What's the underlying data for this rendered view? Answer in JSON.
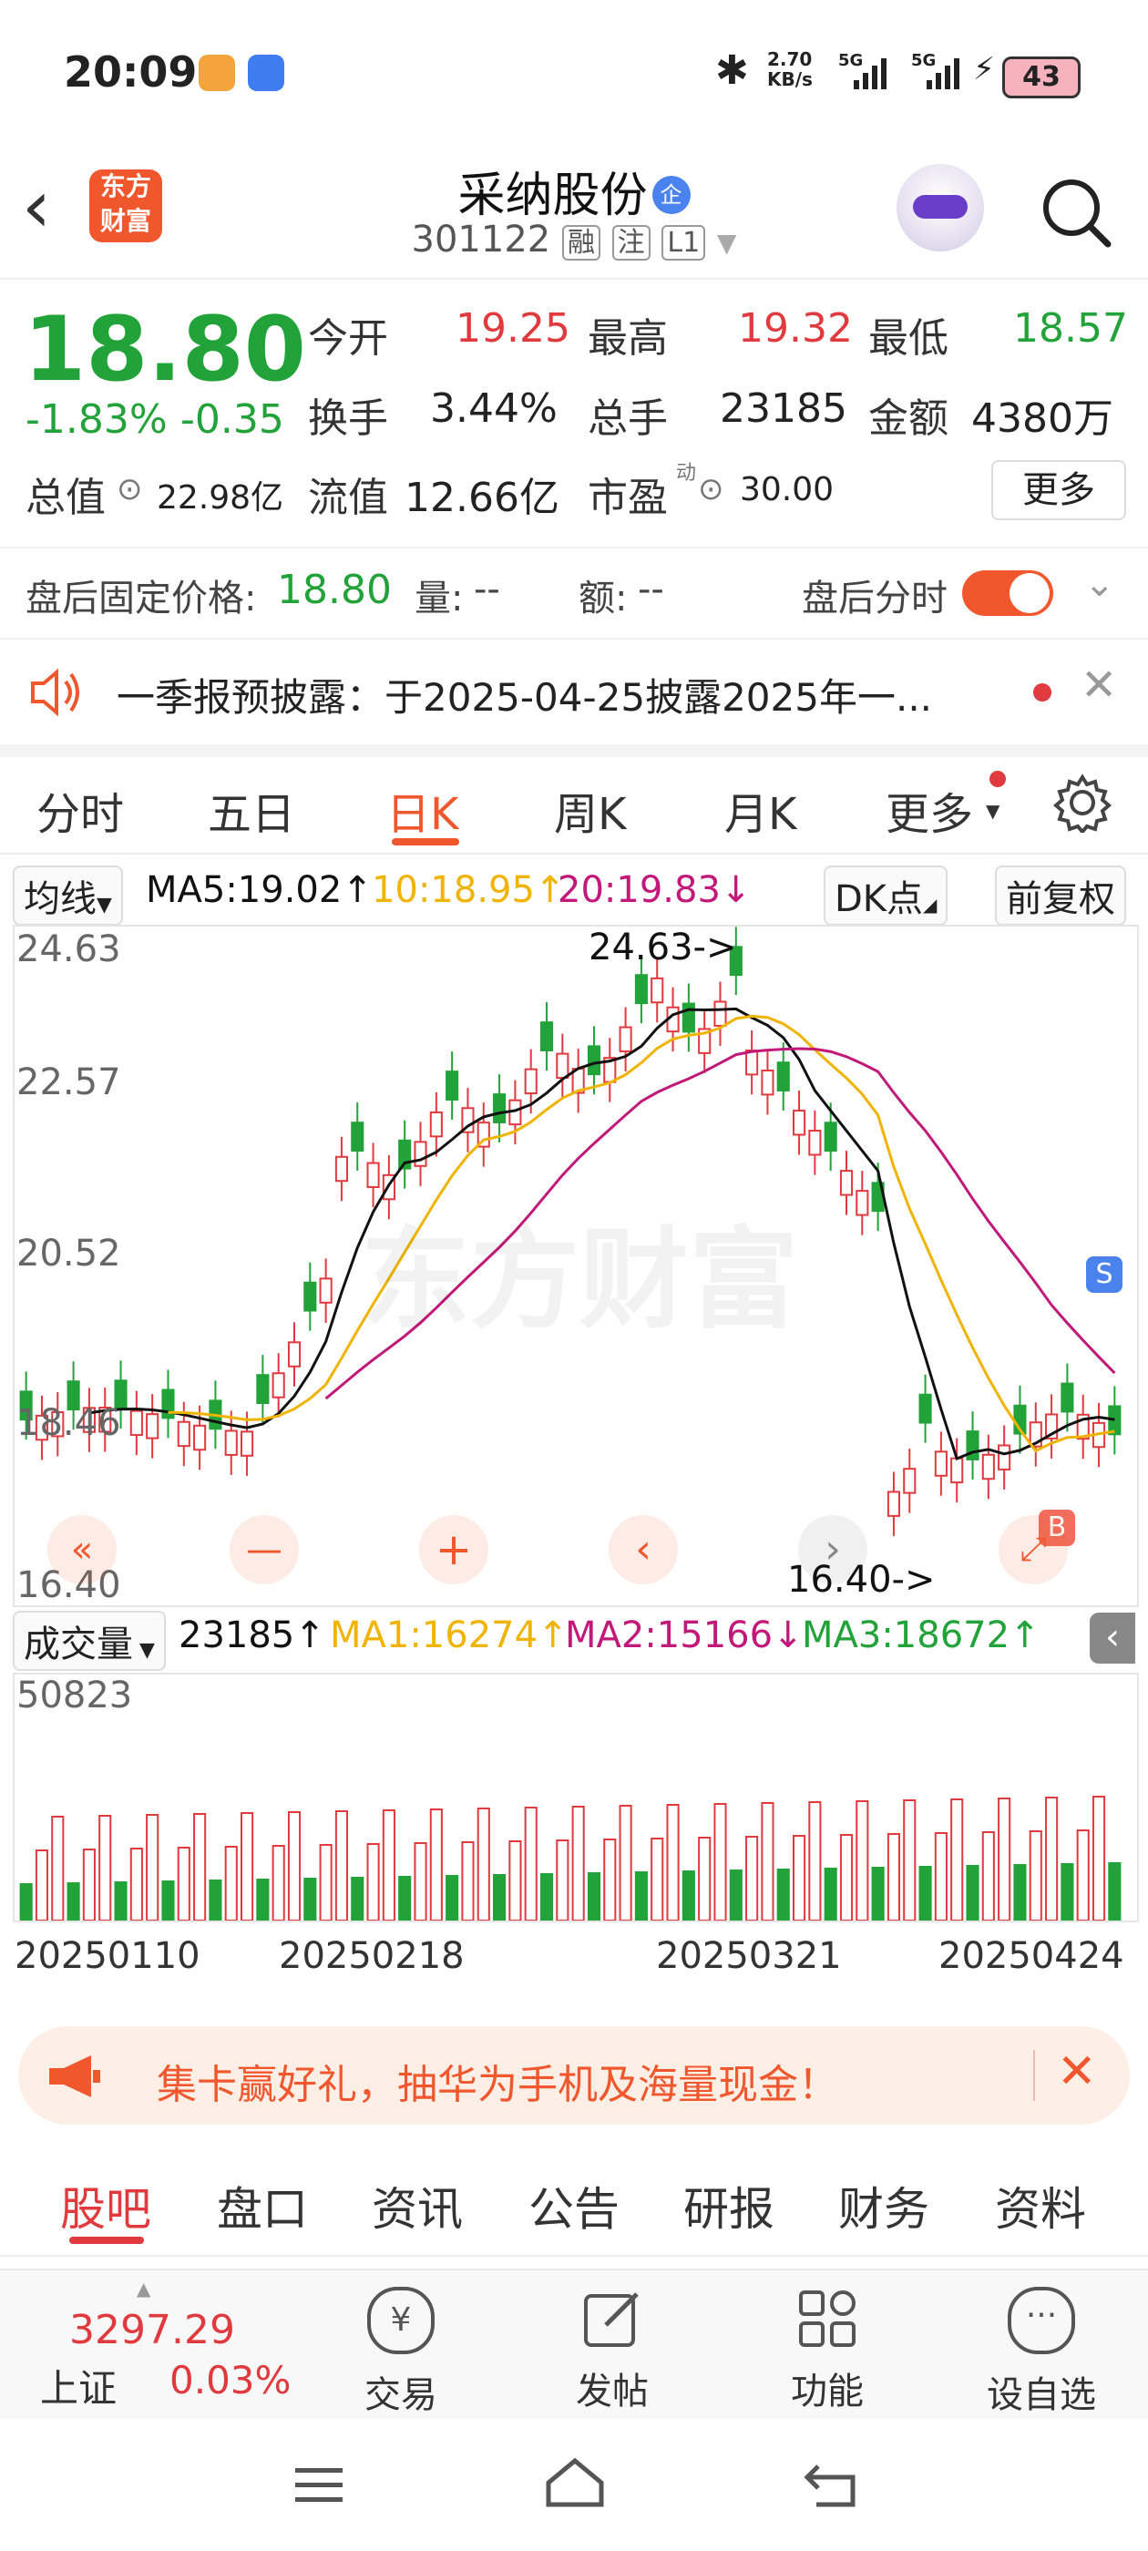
{
  "status": {
    "time": "20:09",
    "net_speed": "2.70",
    "net_unit": "KB/s",
    "net1": "5G",
    "net2": "5G",
    "battery": "43"
  },
  "header": {
    "logo_line1": "东方",
    "logo_line2": "财富",
    "title": "采纳股份",
    "title_badge": "企",
    "code": "301122",
    "tag1": "融",
    "tag2": "注",
    "tag3": "L1"
  },
  "quote": {
    "price": "18.80",
    "change_pct": "-1.83%",
    "change": "-0.35",
    "open_label": "今开",
    "open": "19.25",
    "high_label": "最高",
    "high": "19.32",
    "low_label": "最低",
    "low": "18.57",
    "turnover_label": "换手",
    "turnover": "3.44%",
    "vol_label": "总手",
    "vol": "23185",
    "amount_label": "金额",
    "amount": "4380万",
    "mcap_label": "总值",
    "mcap": "22.98亿",
    "float_label": "流值",
    "float": "12.66亿",
    "pe_label": "市盈",
    "pe_sup": "动",
    "pe": "30.00",
    "more_button": "更多"
  },
  "after_hours": {
    "label": "盘后固定价格:",
    "price": "18.80",
    "vol_label": "量:",
    "vol": "--",
    "amt_label": "额:",
    "amt": "--",
    "toggle_label": "盘后分时"
  },
  "notice": {
    "text": "一季报预披露：于2025-04-25披露2025年一..."
  },
  "ktabs": {
    "tabs": [
      "分时",
      "五日",
      "日K",
      "周K",
      "月K",
      "更多"
    ],
    "active_index": 2
  },
  "ma": {
    "selector": "均线",
    "ma5": "MA5:19.02",
    "ma10": "10:18.95",
    "ma20": "20:19.83",
    "dk": "DK点",
    "fq": "前复权"
  },
  "chart": {
    "y_labels": [
      "24.63",
      "22.57",
      "20.52",
      "18.46",
      "16.40"
    ],
    "high_marker": "24.63->",
    "low_marker": "16.40->",
    "sell_badge": "S",
    "buy_badge": "B",
    "watermark": "东方财富"
  },
  "volume": {
    "selector": "成交量",
    "vol": "23185",
    "ma1": "MA1:16274",
    "ma2": "MA2:15166",
    "ma3": "MA3:18672",
    "top": "50823"
  },
  "dates": [
    "20250110",
    "20250218",
    "20250321",
    "20250424"
  ],
  "promo": {
    "text": "集卡赢好礼，抽华为手机及海量现金！"
  },
  "sections": {
    "items": [
      "股吧",
      "盘口",
      "资讯",
      "公告",
      "研报",
      "财务",
      "资料"
    ],
    "active_index": 0
  },
  "bottom": {
    "index_value": "3297.29",
    "index_name": "上证",
    "index_change": "0.03%",
    "trade": "交易",
    "post": "发帖",
    "func": "功能",
    "watch": "设自选"
  },
  "colors": {
    "up": "#e0393e",
    "down": "#22a33a",
    "accent": "#f0572d",
    "ma5": "#111111",
    "ma10": "#f0b400",
    "ma20": "#c2187a"
  }
}
